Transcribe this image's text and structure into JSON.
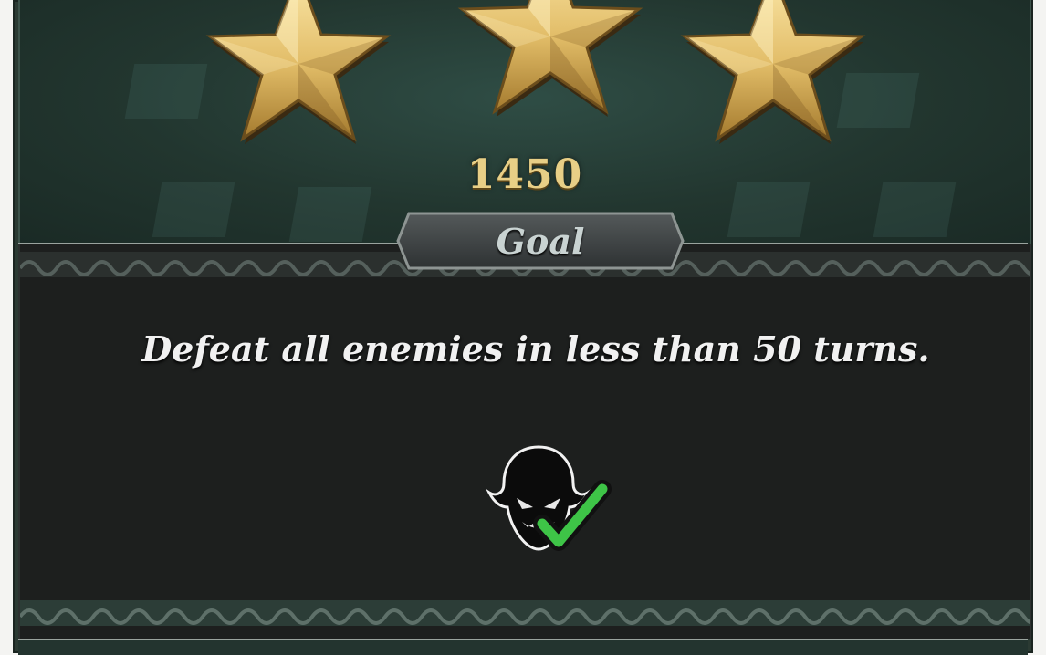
{
  "result": {
    "stars_earned": 3,
    "stars_total": 3,
    "score": "1450"
  },
  "goal": {
    "header": "Goal",
    "description": "Defeat all enemies in less than 50 turns.",
    "status_icon": "enemy-defeated-check-icon",
    "completed": true
  },
  "colors": {
    "star_gold": "#e7c777",
    "score_gold": "#e8cf86",
    "panel_green": "#22362f",
    "goal_bg": "#1d1f1e",
    "check_green": "#3ec447"
  }
}
